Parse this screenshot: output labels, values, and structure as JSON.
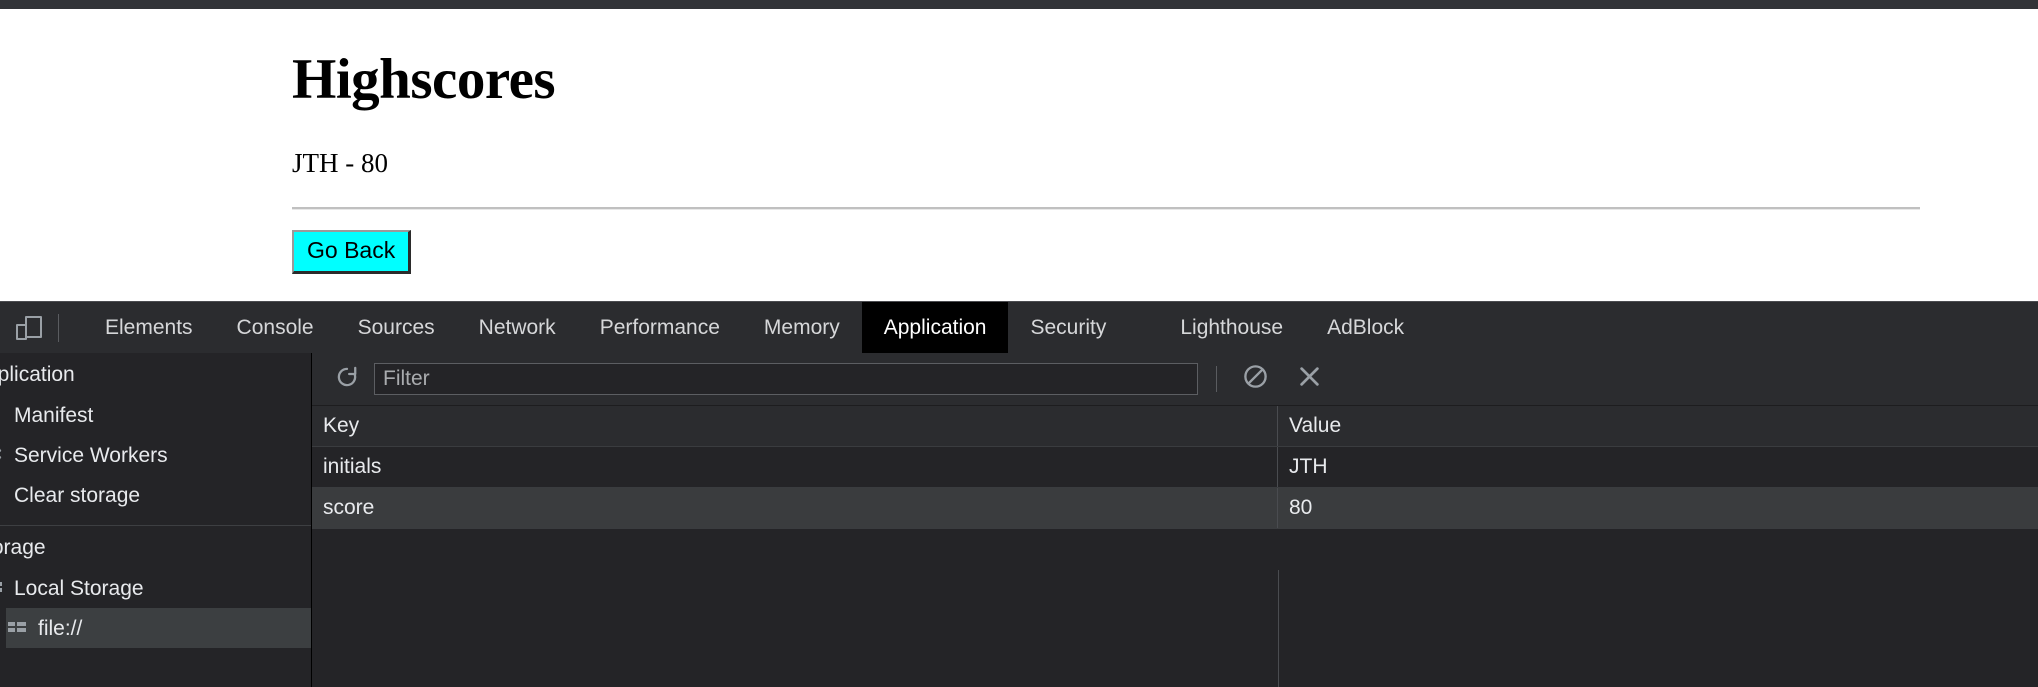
{
  "page": {
    "title": "Highscores",
    "score_line": "JTH - 80",
    "go_back_label": "Go Back"
  },
  "devtools": {
    "device_toolbar_icon": "device-toolbar-icon",
    "tabs": [
      {
        "label": "Elements",
        "selected": false
      },
      {
        "label": "Console",
        "selected": false
      },
      {
        "label": "Sources",
        "selected": false
      },
      {
        "label": "Network",
        "selected": false
      },
      {
        "label": "Performance",
        "selected": false
      },
      {
        "label": "Memory",
        "selected": false
      },
      {
        "label": "Application",
        "selected": true
      },
      {
        "label": "Security",
        "selected": false
      },
      {
        "label": "Lighthouse",
        "selected": false
      },
      {
        "label": "AdBlock",
        "selected": false
      }
    ],
    "sidebar": {
      "application_section": "Application",
      "application_items": [
        {
          "label": "Manifest",
          "icon": "document-icon"
        },
        {
          "label": "Service Workers",
          "icon": "gear-icon"
        },
        {
          "label": "Clear storage",
          "icon": "trash-icon"
        }
      ],
      "storage_section": "Storage",
      "storage_items": [
        {
          "label": "Local Storage",
          "icon": "table-icon",
          "selected": false
        },
        {
          "label": "file://",
          "icon": "table-icon",
          "selected": true
        }
      ]
    },
    "toolbar": {
      "refresh_icon": "refresh-icon",
      "filter_placeholder": "Filter",
      "filter_value": "",
      "clear_all_icon": "clear-all-icon",
      "delete_icon": "delete-icon"
    },
    "table": {
      "columns": [
        "Key",
        "Value"
      ],
      "rows": [
        {
          "key": "initials",
          "value": "JTH"
        },
        {
          "key": "score",
          "value": "80"
        }
      ]
    }
  },
  "colors": {
    "accent_cyan": "#00ffff",
    "devtools_bg": "#242427",
    "devtools_chrome": "#2b2c2f",
    "selected_tab_bg": "#000000"
  }
}
